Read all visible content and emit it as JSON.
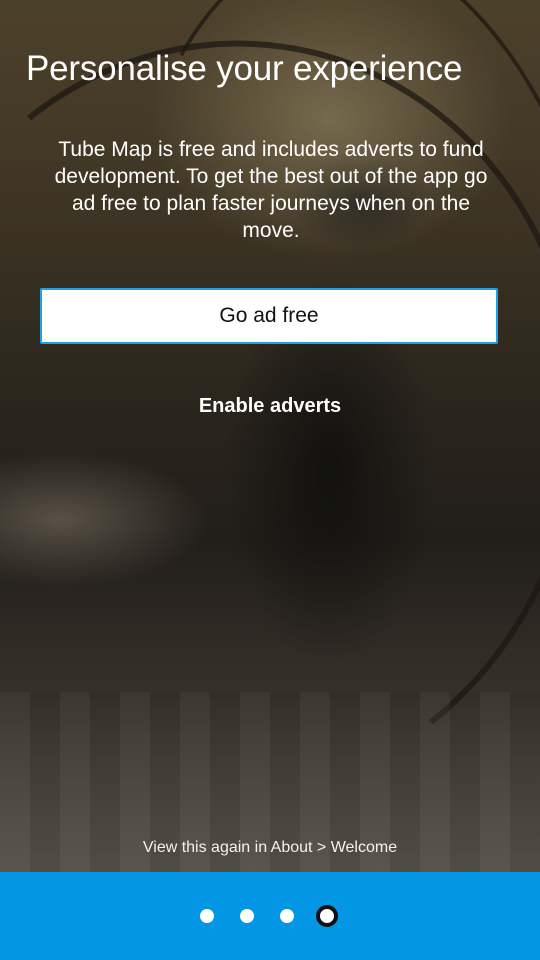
{
  "onboarding": {
    "title": "Personalise your experience",
    "description": "Tube Map is free and includes adverts to fund development. To get the best out of the app go ad free to plan faster journeys when on the move.",
    "primary_button_label": "Go ad free",
    "secondary_link_label": "Enable adverts",
    "hint": "View this again in About > Welcome"
  },
  "page_indicator": {
    "total": 4,
    "active_index": 4
  },
  "colors": {
    "footer_bar": "#0296e5",
    "button_background": "#ffffff",
    "button_border": "#1ea1e8",
    "text_on_image": "#ffffff"
  }
}
